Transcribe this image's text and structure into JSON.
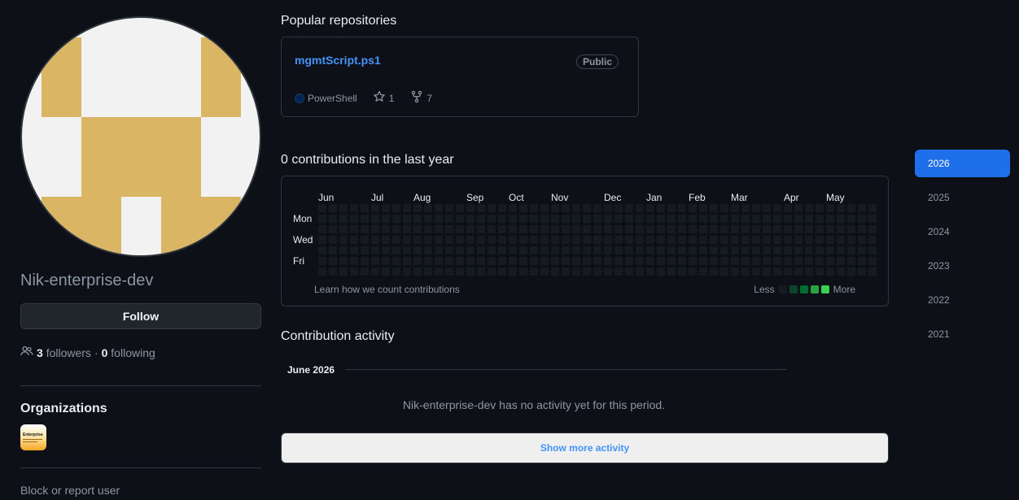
{
  "profile": {
    "username": "Nik-enterprise-dev",
    "follow_label": "Follow",
    "followers_count": "3",
    "followers_label": "followers",
    "separator": "·",
    "following_count": "0",
    "following_label": "following",
    "avatar_colors": {
      "background": "#f2f2f2",
      "block": "#dab563"
    }
  },
  "organizations": {
    "title": "Organizations",
    "org_logo_text": "Enterprise"
  },
  "block_report_label": "Block or report user",
  "popular_repos": {
    "title": "Popular repositories",
    "repos": [
      {
        "name": "mgmtScript.ps1",
        "visibility": "Public",
        "language": "PowerShell",
        "language_color": "#012456",
        "stars": "1",
        "forks": "7"
      }
    ]
  },
  "contributions": {
    "title": "0 contributions in the last year",
    "months": [
      "Jun",
      "Jul",
      "Aug",
      "Sep",
      "Oct",
      "Nov",
      "Dec",
      "Jan",
      "Feb",
      "Mar",
      "Apr",
      "May"
    ],
    "days": [
      "Mon",
      "Wed",
      "Fri"
    ],
    "learn_label": "Learn how we count contributions",
    "legend_less": "Less",
    "legend_more": "More",
    "legend_colors": [
      "#161b22",
      "#0e4429",
      "#006d32",
      "#26a641",
      "#39d353"
    ],
    "empty_cell_color": "#161b22"
  },
  "years": [
    "2026",
    "2025",
    "2024",
    "2023",
    "2022",
    "2021"
  ],
  "selected_year": "2026",
  "activity": {
    "title": "Contribution activity",
    "month_heading": "June 2026",
    "empty_message": "Nik-enterprise-dev has no activity yet for this period.",
    "show_more_label": "Show more activity"
  }
}
